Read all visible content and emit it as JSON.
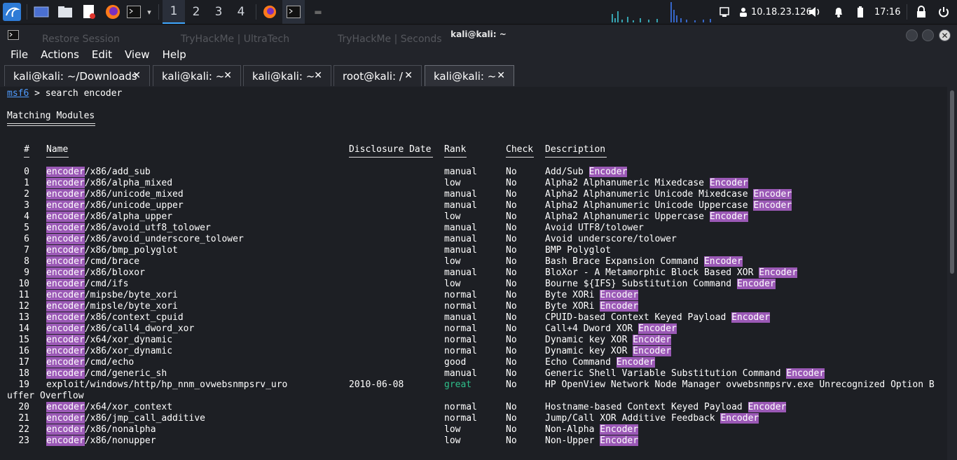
{
  "panel": {
    "workspaces": [
      "1",
      "2",
      "3",
      "4"
    ],
    "ip": "10.18.23.126",
    "time": "17:16"
  },
  "window": {
    "title": "kali@kali: ~",
    "ghost_tabs": [
      "Restore Session",
      "TryHackMe | UltraTech",
      "TryHackMe | Seconds"
    ]
  },
  "menu": [
    "File",
    "Actions",
    "Edit",
    "View",
    "Help"
  ],
  "tabs": [
    {
      "label": "kali@kali: ~/Downloads"
    },
    {
      "label": "kali@kali: ~"
    },
    {
      "label": "kali@kali: ~"
    },
    {
      "label": "root@kali: /"
    },
    {
      "label": "kali@kali: ~"
    }
  ],
  "colors": {
    "accent": "#3fa7ff",
    "highlight": "#9b59b6",
    "great": "#2ebf8a"
  },
  "terminal": {
    "prompt_word": "msf6",
    "prompt_rest": " > search encoder",
    "heading": "Matching Modules",
    "columns": {
      "num": "#",
      "name": "Name",
      "date": "Disclosure Date",
      "rank": "Rank",
      "check": "Check",
      "desc": "Description"
    },
    "rows": [
      {
        "n": "0",
        "hl": "encoder",
        "path": "/x86/add_sub",
        "date": "",
        "rank": "manual",
        "check": "No",
        "desc": "Add/Sub ",
        "dhl": "Encoder"
      },
      {
        "n": "1",
        "hl": "encoder",
        "path": "/x86/alpha_mixed",
        "date": "",
        "rank": "low",
        "check": "No",
        "desc": "Alpha2 Alphanumeric Mixedcase ",
        "dhl": "Encoder"
      },
      {
        "n": "2",
        "hl": "encoder",
        "path": "/x86/unicode_mixed",
        "date": "",
        "rank": "manual",
        "check": "No",
        "desc": "Alpha2 Alphanumeric Unicode Mixedcase ",
        "dhl": "Encoder"
      },
      {
        "n": "3",
        "hl": "encoder",
        "path": "/x86/unicode_upper",
        "date": "",
        "rank": "manual",
        "check": "No",
        "desc": "Alpha2 Alphanumeric Unicode Uppercase ",
        "dhl": "Encoder"
      },
      {
        "n": "4",
        "hl": "encoder",
        "path": "/x86/alpha_upper",
        "date": "",
        "rank": "low",
        "check": "No",
        "desc": "Alpha2 Alphanumeric Uppercase ",
        "dhl": "Encoder"
      },
      {
        "n": "5",
        "hl": "encoder",
        "path": "/x86/avoid_utf8_tolower",
        "date": "",
        "rank": "manual",
        "check": "No",
        "desc": "Avoid UTF8/tolower",
        "dhl": ""
      },
      {
        "n": "6",
        "hl": "encoder",
        "path": "/x86/avoid_underscore_tolower",
        "date": "",
        "rank": "manual",
        "check": "No",
        "desc": "Avoid underscore/tolower",
        "dhl": ""
      },
      {
        "n": "7",
        "hl": "encoder",
        "path": "/x86/bmp_polyglot",
        "date": "",
        "rank": "manual",
        "check": "No",
        "desc": "BMP Polyglot",
        "dhl": ""
      },
      {
        "n": "8",
        "hl": "encoder",
        "path": "/cmd/brace",
        "date": "",
        "rank": "low",
        "check": "No",
        "desc": "Bash Brace Expansion Command ",
        "dhl": "Encoder"
      },
      {
        "n": "9",
        "hl": "encoder",
        "path": "/x86/bloxor",
        "date": "",
        "rank": "manual",
        "check": "No",
        "desc": "BloXor - A Metamorphic Block Based XOR ",
        "dhl": "Encoder"
      },
      {
        "n": "10",
        "hl": "encoder",
        "path": "/cmd/ifs",
        "date": "",
        "rank": "low",
        "check": "No",
        "desc": "Bourne ${IFS} Substitution Command ",
        "dhl": "Encoder"
      },
      {
        "n": "11",
        "hl": "encoder",
        "path": "/mipsbe/byte_xori",
        "date": "",
        "rank": "normal",
        "check": "No",
        "desc": "Byte XORi ",
        "dhl": "Encoder"
      },
      {
        "n": "12",
        "hl": "encoder",
        "path": "/mipsle/byte_xori",
        "date": "",
        "rank": "normal",
        "check": "No",
        "desc": "Byte XORi ",
        "dhl": "Encoder"
      },
      {
        "n": "13",
        "hl": "encoder",
        "path": "/x86/context_cpuid",
        "date": "",
        "rank": "manual",
        "check": "No",
        "desc": "CPUID-based Context Keyed Payload ",
        "dhl": "Encoder"
      },
      {
        "n": "14",
        "hl": "encoder",
        "path": "/x86/call4_dword_xor",
        "date": "",
        "rank": "normal",
        "check": "No",
        "desc": "Call+4 Dword XOR ",
        "dhl": "Encoder"
      },
      {
        "n": "15",
        "hl": "encoder",
        "path": "/x64/xor_dynamic",
        "date": "",
        "rank": "normal",
        "check": "No",
        "desc": "Dynamic key XOR ",
        "dhl": "Encoder"
      },
      {
        "n": "16",
        "hl": "encoder",
        "path": "/x86/xor_dynamic",
        "date": "",
        "rank": "normal",
        "check": "No",
        "desc": "Dynamic key XOR ",
        "dhl": "Encoder"
      },
      {
        "n": "17",
        "hl": "encoder",
        "path": "/cmd/echo",
        "date": "",
        "rank": "good",
        "check": "No",
        "desc": "Echo Command ",
        "dhl": "Encoder"
      },
      {
        "n": "18",
        "hl": "encoder",
        "path": "/cmd/generic_sh",
        "date": "",
        "rank": "manual",
        "check": "No",
        "desc": "Generic Shell Variable Substitution Command ",
        "dhl": "Encoder"
      },
      {
        "n": "19",
        "hl": "",
        "path": "exploit/windows/http/hp_nnm_ovwebsnmpsrv_uro",
        "date": "2010-06-08",
        "rank": "great",
        "check": "No",
        "desc": "HP OpenView Network Node Manager ovwebsnmpsrv.exe Unrecognized Option B",
        "dhl": "",
        "wrap": "uffer Overflow"
      },
      {
        "n": "20",
        "hl": "encoder",
        "path": "/x64/xor_context",
        "date": "",
        "rank": "normal",
        "check": "No",
        "desc": "Hostname-based Context Keyed Payload ",
        "dhl": "Encoder"
      },
      {
        "n": "21",
        "hl": "encoder",
        "path": "/x86/jmp_call_additive",
        "date": "",
        "rank": "normal",
        "check": "No",
        "desc": "Jump/Call XOR Additive Feedback ",
        "dhl": "Encoder"
      },
      {
        "n": "22",
        "hl": "encoder",
        "path": "/x86/nonalpha",
        "date": "",
        "rank": "low",
        "check": "No",
        "desc": "Non-Alpha ",
        "dhl": "Encoder"
      },
      {
        "n": "23",
        "hl": "encoder",
        "path": "/x86/nonupper",
        "date": "",
        "rank": "low",
        "check": "No",
        "desc": "Non-Upper ",
        "dhl": "Encoder"
      }
    ]
  }
}
